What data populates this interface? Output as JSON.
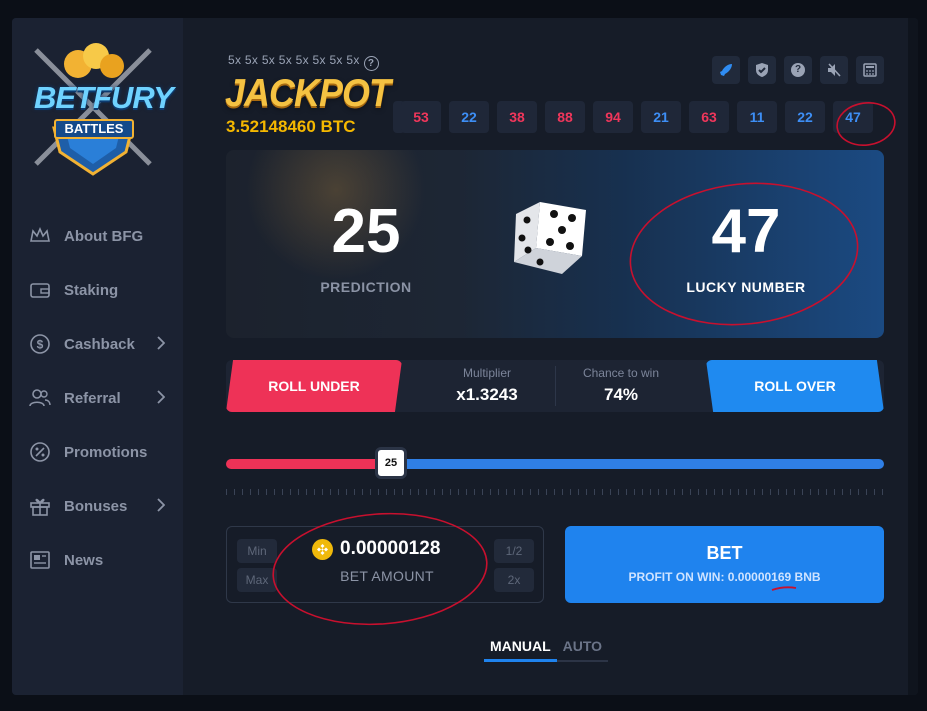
{
  "brand": {
    "logo_top": "BETFURY",
    "logo_bottom": "BATTLES"
  },
  "sidebar": {
    "items": [
      {
        "label": "About BFG",
        "icon": "crown-icon",
        "chevron": false
      },
      {
        "label": "Staking",
        "icon": "wallet-icon",
        "chevron": false
      },
      {
        "label": "Cashback",
        "icon": "dollar-circle-icon",
        "chevron": true
      },
      {
        "label": "Referral",
        "icon": "users-icon",
        "chevron": true
      },
      {
        "label": "Promotions",
        "icon": "percent-icon",
        "chevron": false
      },
      {
        "label": "Bonuses",
        "icon": "gift-icon",
        "chevron": true
      },
      {
        "label": "News",
        "icon": "newspaper-icon",
        "chevron": false
      }
    ]
  },
  "jackpot": {
    "multipliers": "5x 5x 5x 5x 5x 5x 5x 5x",
    "title": "JACKPOT",
    "value": "3.52148460 BTC"
  },
  "top_icons": [
    "rocket-icon",
    "shield-icon",
    "help-icon",
    "mute-icon",
    "calculator-icon"
  ],
  "history": [
    {
      "value": "53",
      "color": "#f0365b"
    },
    {
      "value": "22",
      "color": "#3d8ef5"
    },
    {
      "value": "38",
      "color": "#f0365b"
    },
    {
      "value": "88",
      "color": "#f0365b"
    },
    {
      "value": "94",
      "color": "#f0365b"
    },
    {
      "value": "21",
      "color": "#3d8ef5"
    },
    {
      "value": "63",
      "color": "#f0365b"
    },
    {
      "value": "11",
      "color": "#3d8ef5"
    },
    {
      "value": "22",
      "color": "#3d8ef5"
    },
    {
      "value": "47",
      "color": "#3d8ef5"
    }
  ],
  "game": {
    "prediction": "25",
    "prediction_label": "PREDICTION",
    "lucky_number": "47",
    "lucky_label": "LUCKY NUMBER"
  },
  "controls": {
    "roll_under": "ROLL UNDER",
    "roll_over": "ROLL OVER",
    "multiplier_label": "Multiplier",
    "multiplier_value": "x1.3243",
    "chance_label": "Chance to win",
    "chance_value": "74%"
  },
  "slider": {
    "value": 25,
    "min": 0,
    "max": 100,
    "label": "25"
  },
  "bet": {
    "min_label": "Min",
    "max_label": "Max",
    "half_label": "1/2",
    "double_label": "2x",
    "amount": "0.00000128",
    "amount_label": "BET AMOUNT",
    "bet_label": "BET",
    "profit_text": "PROFIT ON WIN: 0.00000169 BNB"
  },
  "tabs": [
    {
      "label": "MANUAL",
      "active": true
    },
    {
      "label": "AUTO",
      "active": false
    }
  ],
  "colors": {
    "red": "#ee3257",
    "blue": "#1f83ee",
    "gold": "#f5b800",
    "annotation": "#c8102e"
  }
}
